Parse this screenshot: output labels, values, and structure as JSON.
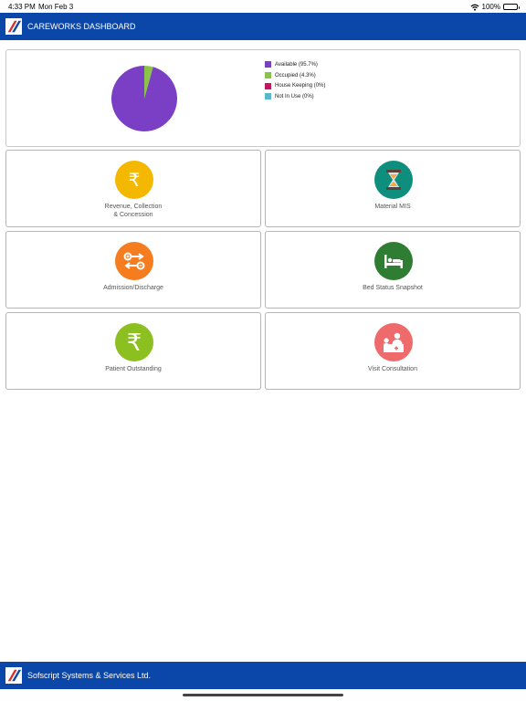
{
  "status_bar": {
    "time": "4:33 PM",
    "date": "Mon Feb 3",
    "battery": "100%"
  },
  "header": {
    "title": "CAREWORKS DASHBOARD"
  },
  "bed_chart": {
    "legend": [
      {
        "label": "Available (95.7%)",
        "color": "#7b3fc6"
      },
      {
        "label": "Occupied (4.3%)",
        "color": "#8bc34a"
      },
      {
        "label": "House Keeping (0%)",
        "color": "#c2185b"
      },
      {
        "label": "Not In Use (0%)",
        "color": "#5bb8c9"
      }
    ]
  },
  "chart_data": {
    "type": "pie",
    "categories": [
      "Available",
      "Occupied",
      "House Keeping",
      "Not In Use"
    ],
    "values": [
      95.7,
      4.3,
      0,
      0
    ],
    "colors": [
      "#7b3fc6",
      "#8bc34a",
      "#c2185b",
      "#5bb8c9"
    ],
    "legend_position": "right"
  },
  "tiles": [
    {
      "label": "Revenue, Collection\n& Concession",
      "icon": "rupee-icon",
      "color": "#f5b800"
    },
    {
      "label": "Material MIS",
      "icon": "hourglass-icon",
      "color": "#0e8f7e"
    },
    {
      "label": "Admission/Discharge",
      "icon": "admission-discharge-icon",
      "color": "#f57c1f"
    },
    {
      "label": "Bed Status Snapshot",
      "icon": "bed-icon",
      "color": "#2e7d32"
    },
    {
      "label": "Patient Outstanding",
      "icon": "rupee-icon",
      "color": "#8cc021"
    },
    {
      "label": "Visit Consultation",
      "icon": "doctor-consultation-icon",
      "color": "#ef6b6b"
    }
  ],
  "footer": {
    "company": "Sofscript Systems & Services Ltd."
  },
  "brand_color": "#0b47a8"
}
